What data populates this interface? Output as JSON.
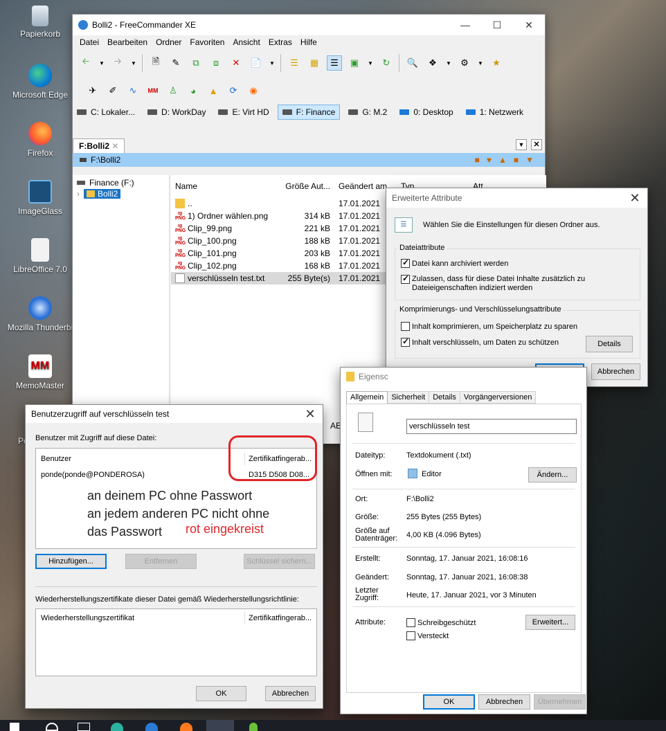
{
  "desktop": {
    "icons": [
      {
        "label": "Papierkorb"
      },
      {
        "label": "Microsoft Edge"
      },
      {
        "label": "Firefox"
      },
      {
        "label": "ImageGlass"
      },
      {
        "label": "LibreOffice 7.0"
      },
      {
        "label": "Mozilla Thunderbi"
      },
      {
        "label": "MemoMaster"
      },
      {
        "label": "Powe"
      }
    ]
  },
  "fc": {
    "title": "Bolli2 - FreeCommander XE",
    "menu": [
      "Datei",
      "Bearbeiten",
      "Ordner",
      "Favoriten",
      "Ansicht",
      "Extras",
      "Hilfe"
    ],
    "drives": [
      "C: Lokaler...",
      "D: WorkDay",
      "E: Virt HD",
      "F: Finance",
      "G: M.2",
      "0: Desktop",
      "1: Netzwerk"
    ],
    "tab": "F:Bolli2",
    "path": "F:\\Bolli2",
    "tree": {
      "root": "Finance (F:)",
      "child": "Bolli2"
    },
    "columns": {
      "name": "Name",
      "size": "Größe Aut...",
      "date": "Geändert am",
      "type": "Typ",
      "attr": "Att..."
    },
    "files": [
      {
        "name": "..",
        "size": "",
        "date": "17.01.2021"
      },
      {
        "name": "1) Ordner wählen.png",
        "size": "314 kB",
        "date": "17.01.2021"
      },
      {
        "name": "Clip_99.png",
        "size": "221 kB",
        "date": "17.01.2021"
      },
      {
        "name": "Clip_100.png",
        "size": "188 kB",
        "date": "17.01.2021"
      },
      {
        "name": "Clip_101.png",
        "size": "203 kB",
        "date": "17.01.2021"
      },
      {
        "name": "Clip_102.png",
        "size": "168 kB",
        "date": "17.01.2021"
      },
      {
        "name": "verschlüsseln test.txt",
        "size": "255 Byte(s)",
        "date": "17.01.2021"
      }
    ]
  },
  "adv": {
    "title": "Erweiterte Attribute",
    "intro": "Wählen Sie die Einstellungen für diesen Ordner aus.",
    "group1": "Dateiattribute",
    "archive": "Datei kann archiviert werden",
    "index": "Zulassen, dass für diese Datei Inhalte zusätzlich zu Dateieigenschaften indiziert werden",
    "group2": "Komprimierungs- und Verschlüsselungsattribute",
    "compress": "Inhalt komprimieren, um Speicherplatz zu sparen",
    "encrypt": "Inhalt verschlüsseln, um Daten zu schützen",
    "details": "Details",
    "ok": "OK",
    "cancel": "Abbrechen"
  },
  "props": {
    "title": "Eigensc",
    "tabs": [
      "Allgemein",
      "Sicherheit",
      "Details",
      "Vorgängerversionen"
    ],
    "filename": "verschlüsseln test",
    "type_label": "Dateityp:",
    "type_value": "Textdokument (.txt)",
    "open_label": "Öffnen mit:",
    "open_value": "Editor",
    "change": "Ändern...",
    "loc_label": "Ort:",
    "loc_value": "F:\\Bolli2",
    "size_label": "Größe:",
    "size_value": "255 Bytes (255 Bytes)",
    "disk_label": "Größe auf Datenträger:",
    "disk_value": "4,00 KB (4.096 Bytes)",
    "created_label": "Erstellt:",
    "created_value": "Sonntag, 17. Januar 2021, 16:08:16",
    "modified_label": "Geändert:",
    "modified_value": "Sonntag, 17. Januar 2021, 16:08:38",
    "access_label": "Letzter Zugriff:",
    "access_value": "Heute, 17. Januar 2021, vor 3 Minuten",
    "attr_label": "Attribute:",
    "readonly": "Schreibgeschützt",
    "hidden": "Versteckt",
    "advanced": "Erweitert...",
    "ok": "OK",
    "cancel": "Abbrechen",
    "apply": "Übernehmen"
  },
  "access": {
    "title": "Benutzerzugriff auf verschlüsseln test",
    "users_label": "Benutzer mit Zugriff auf diese Datei:",
    "col_user": "Benutzer",
    "col_thumb": "Zertifikatfingerab...",
    "user": "ponde(ponde@PONDEROSA)",
    "thumb": "D315 D508 D08...",
    "note1": "an deinem PC ohne Passwort",
    "note2": "an jedem anderen PC nicht ohne",
    "note3": "das Passwort",
    "note_red": "rot eingekreist",
    "add": "Hinzufügen...",
    "remove": "Entfernen",
    "backup": "Schlüssel sichern...",
    "recovery_label": "Wiederherstellungszertifikate dieser Datei gemäß Wiederherstellungsrichtlinie:",
    "col_cert": "Wiederherstellungszertifikat",
    "col_thumb2": "Zertifikatfingerab...",
    "ok": "OK",
    "cancel": "Abbrechen"
  },
  "behind": {
    "text": "AE ("
  }
}
